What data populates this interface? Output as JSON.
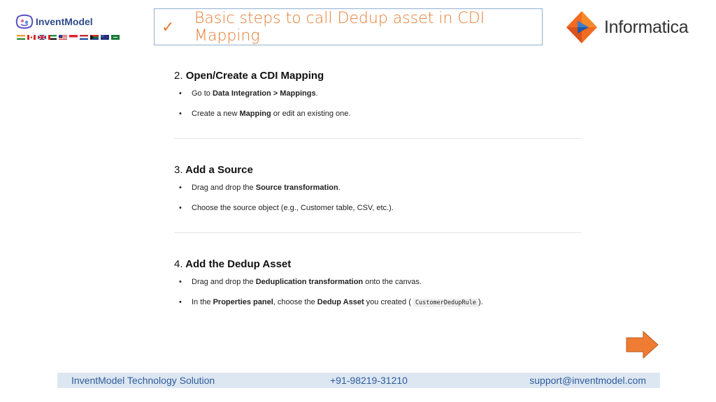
{
  "header": {
    "brand_name": "InventModel",
    "slide_title": "Basic steps to call Dedup asset in CDI Mapping",
    "partner_brand": "Informatica"
  },
  "sections": [
    {
      "number": "2.",
      "title": "Open/Create a CDI Mapping",
      "bullets": [
        {
          "pre": "Go to ",
          "bold1": "Data Integration > Mappings",
          "mid": ".",
          "bold2": "",
          "code": "",
          "post": ""
        },
        {
          "pre": "Create a new ",
          "bold1": "Mapping",
          "mid": " or edit an existing one.",
          "bold2": "",
          "code": "",
          "post": ""
        }
      ]
    },
    {
      "number": "3.",
      "title": "Add a Source",
      "bullets": [
        {
          "pre": "Drag and drop the ",
          "bold1": "Source transformation",
          "mid": ".",
          "bold2": "",
          "code": "",
          "post": ""
        },
        {
          "pre": "Choose the source object (e.g., Customer table, CSV, etc.).",
          "bold1": "",
          "mid": "",
          "bold2": "",
          "code": "",
          "post": ""
        }
      ]
    },
    {
      "number": "4.",
      "title": "Add the Dedup Asset",
      "bullets": [
        {
          "pre": "Drag and drop the ",
          "bold1": "Deduplication transformation",
          "mid": " onto the canvas.",
          "bold2": "",
          "code": "",
          "post": ""
        },
        {
          "pre": "In the ",
          "bold1": "Properties panel",
          "mid": ", choose the ",
          "bold2": "Dedup Asset",
          "code": "CustomerDedupRule",
          "post": ")."
        }
      ]
    }
  ],
  "bullet4b_extra": " you created ( ",
  "footer": {
    "company": "InventModel Technology Solution",
    "phone": "+91-98219-31210",
    "email": "support@inventmodel.com"
  },
  "colors": {
    "accent_orange": "#e57c32",
    "footer_bg": "#dde7f2",
    "footer_text": "#2e5b9a"
  },
  "icons": [
    "inventmodel-logo-icon",
    "checkmark-icon",
    "informatica-logo-icon",
    "next-arrow-icon"
  ]
}
